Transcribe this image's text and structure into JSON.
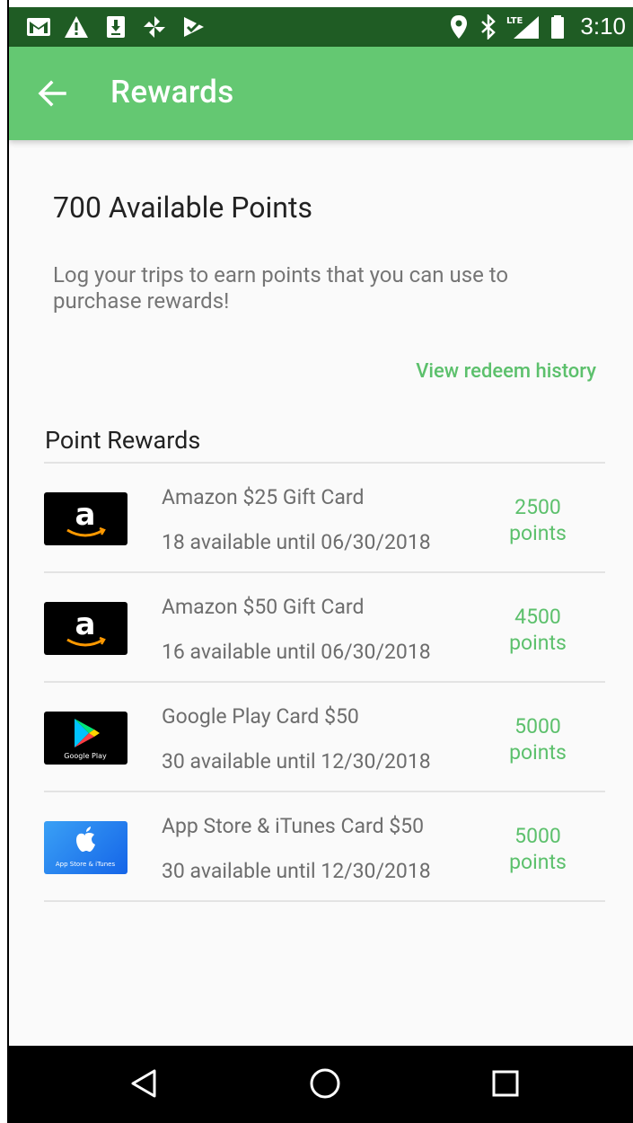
{
  "status_bar": {
    "time": "3:10",
    "left_icons": [
      "gmail-icon",
      "warning-icon",
      "download-icon",
      "pinwheel-icon",
      "checkmark-flag-icon"
    ],
    "right_icons": [
      "location-icon",
      "bluetooth-icon",
      "lte-signal-icon",
      "battery-icon"
    ],
    "lte_label": "LTE"
  },
  "app_bar": {
    "title": "Rewards",
    "back_icon": "back-arrow-icon",
    "color": "#64c872"
  },
  "summary": {
    "points_title": "700 Available Points",
    "description": "Log your trips to earn points that you can use to purchase rewards!",
    "history_link": "View redeem history"
  },
  "section": {
    "title": "Point Rewards"
  },
  "rewards": [
    {
      "name": "Amazon $25 Gift Card",
      "availability": "18 available until 06/30/2018",
      "points_value": "2500",
      "points_unit": "points",
      "image": "amazon-logo-icon"
    },
    {
      "name": "Amazon $50 Gift Card",
      "availability": "16 available until 06/30/2018",
      "points_value": "4500",
      "points_unit": "points",
      "image": "amazon-logo-icon"
    },
    {
      "name": "Google Play Card $50",
      "availability": "30 available until 12/30/2018",
      "points_value": "5000",
      "points_unit": "points",
      "image": "google-play-logo-icon",
      "image_label": "Google Play"
    },
    {
      "name": "App Store & iTunes Card $50",
      "availability": "30 available until 12/30/2018",
      "points_value": "5000",
      "points_unit": "points",
      "image": "apple-logo-icon",
      "image_label": "App Store & iTunes"
    }
  ],
  "nav_bar": {
    "buttons": [
      "back-triangle-icon",
      "home-circle-icon",
      "recents-square-icon"
    ]
  },
  "colors": {
    "status_bar": "#1f5c24",
    "accent": "#5cc06c",
    "nav_bar": "#000000"
  }
}
